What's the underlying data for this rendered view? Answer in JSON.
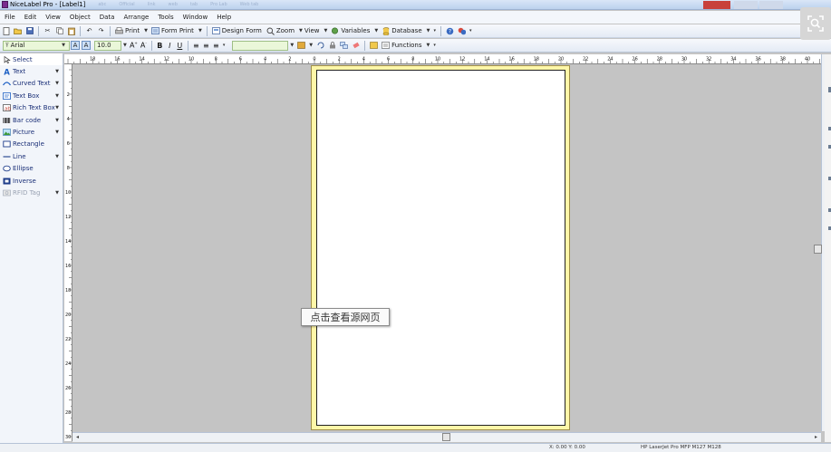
{
  "window": {
    "title": "NiceLabel Pro - [Label1]",
    "ghost_titles": [
      "abc",
      "Official",
      "link",
      "web",
      "tab",
      "Pro Lab",
      "Web tab"
    ]
  },
  "menu": [
    "File",
    "Edit",
    "View",
    "Object",
    "Data",
    "Arrange",
    "Tools",
    "Window",
    "Help"
  ],
  "toolbar1": {
    "print": "Print",
    "form_print": "Form Print",
    "design_form": "Design Form",
    "zoom": "Zoom",
    "view": "View",
    "variables": "Variables",
    "database": "Database"
  },
  "toolbar2": {
    "font_name": "Arial",
    "font_size": "10.0",
    "functions": "Functions",
    "bold": "B",
    "italic": "I",
    "underline": "U"
  },
  "toolbox": [
    {
      "label": "Select",
      "icon": "cursor-icon",
      "dropdown": false,
      "disabled": false
    },
    {
      "label": "Text",
      "icon": "text-tool-icon",
      "dropdown": true,
      "disabled": false
    },
    {
      "label": "Curved Text",
      "icon": "curved-text-icon",
      "dropdown": true,
      "disabled": false
    },
    {
      "label": "Text Box",
      "icon": "text-box-icon",
      "dropdown": true,
      "disabled": false
    },
    {
      "label": "Rich Text Box",
      "icon": "rich-text-box-icon",
      "dropdown": true,
      "disabled": false
    },
    {
      "label": "Bar code",
      "icon": "barcode-icon",
      "dropdown": true,
      "disabled": false
    },
    {
      "label": "Picture",
      "icon": "picture-icon",
      "dropdown": true,
      "disabled": false
    },
    {
      "label": "Rectangle",
      "icon": "rectangle-icon",
      "dropdown": false,
      "disabled": false
    },
    {
      "label": "Line",
      "icon": "line-icon",
      "dropdown": true,
      "disabled": false
    },
    {
      "label": "Ellipse",
      "icon": "ellipse-icon",
      "dropdown": false,
      "disabled": false
    },
    {
      "label": "Inverse",
      "icon": "inverse-icon",
      "dropdown": false,
      "disabled": false
    },
    {
      "label": "RFID Tag",
      "icon": "rfid-icon",
      "dropdown": true,
      "disabled": true
    }
  ],
  "ruler": {
    "h_labels": [
      "18",
      "16",
      "14",
      "12",
      "10",
      "8",
      "6",
      "4",
      "2",
      "0",
      "2",
      "4",
      "6",
      "8",
      "10",
      "12",
      "14",
      "16",
      "18",
      "20",
      "22",
      "24",
      "26",
      "28",
      "30",
      "32",
      "34",
      "36",
      "38",
      "40"
    ],
    "v_labels": [
      "2",
      "4",
      "6",
      "8",
      "10",
      "12",
      "14",
      "16",
      "18",
      "20",
      "22",
      "24",
      "26",
      "28",
      "30"
    ]
  },
  "tooltip": "点击查看源网页",
  "status": {
    "xy": "X: 0.00 Y: 0.00",
    "printer": "HP LaserJet Pro MFP M127 M128"
  },
  "colors": {
    "label_border": "#fff7a8",
    "toolbar_bg": "#e4ebf5",
    "font_combo_bg": "#eaf7d9"
  }
}
